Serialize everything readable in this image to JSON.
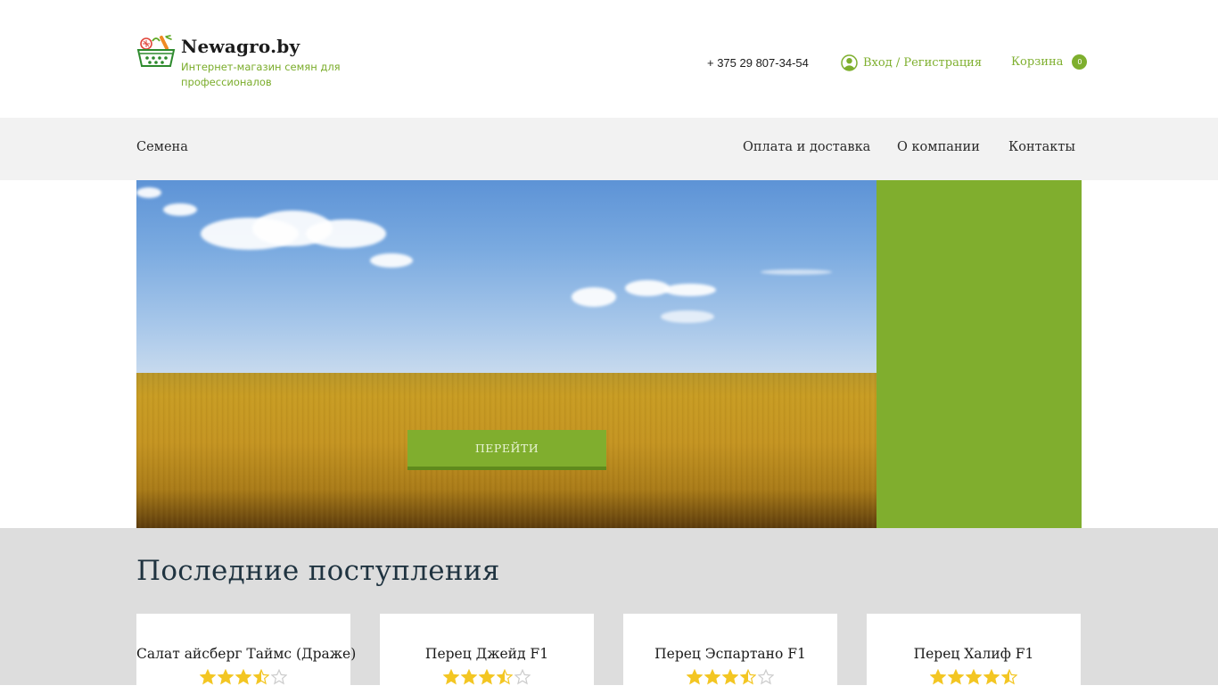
{
  "header": {
    "brand_name": "Newagro.by",
    "tagline": "Интернет-магазин семян для профессионалов",
    "phone": "+ 375 29 807-34-54",
    "login_text": "Вход / Регистрация",
    "cart_label": "Корзина",
    "cart_count": "0"
  },
  "nav": {
    "items": [
      {
        "label": "Семена"
      },
      {
        "label": "Оплата и доставка"
      },
      {
        "label": "О компании"
      },
      {
        "label": "Контакты"
      }
    ]
  },
  "hero": {
    "button_label": "ПЕРЕЙТИ"
  },
  "latest": {
    "title": "Последние поступления",
    "products": [
      {
        "name": "Салат айсберг Таймс (Драже)",
        "rating": 3.5
      },
      {
        "name": "Перец Джейд F1",
        "rating": 3.5
      },
      {
        "name": "Перец Эспартано F1",
        "rating": 3.5
      },
      {
        "name": "Перец Халиф F1",
        "rating": 4.5
      }
    ]
  },
  "colors": {
    "accent_green": "#80ae2e",
    "star_gold": "#f3c623",
    "star_empty": "#cccccc"
  },
  "icons": {
    "logo": "basket-with-vegetables-icon",
    "login": "user-circle-icon"
  }
}
